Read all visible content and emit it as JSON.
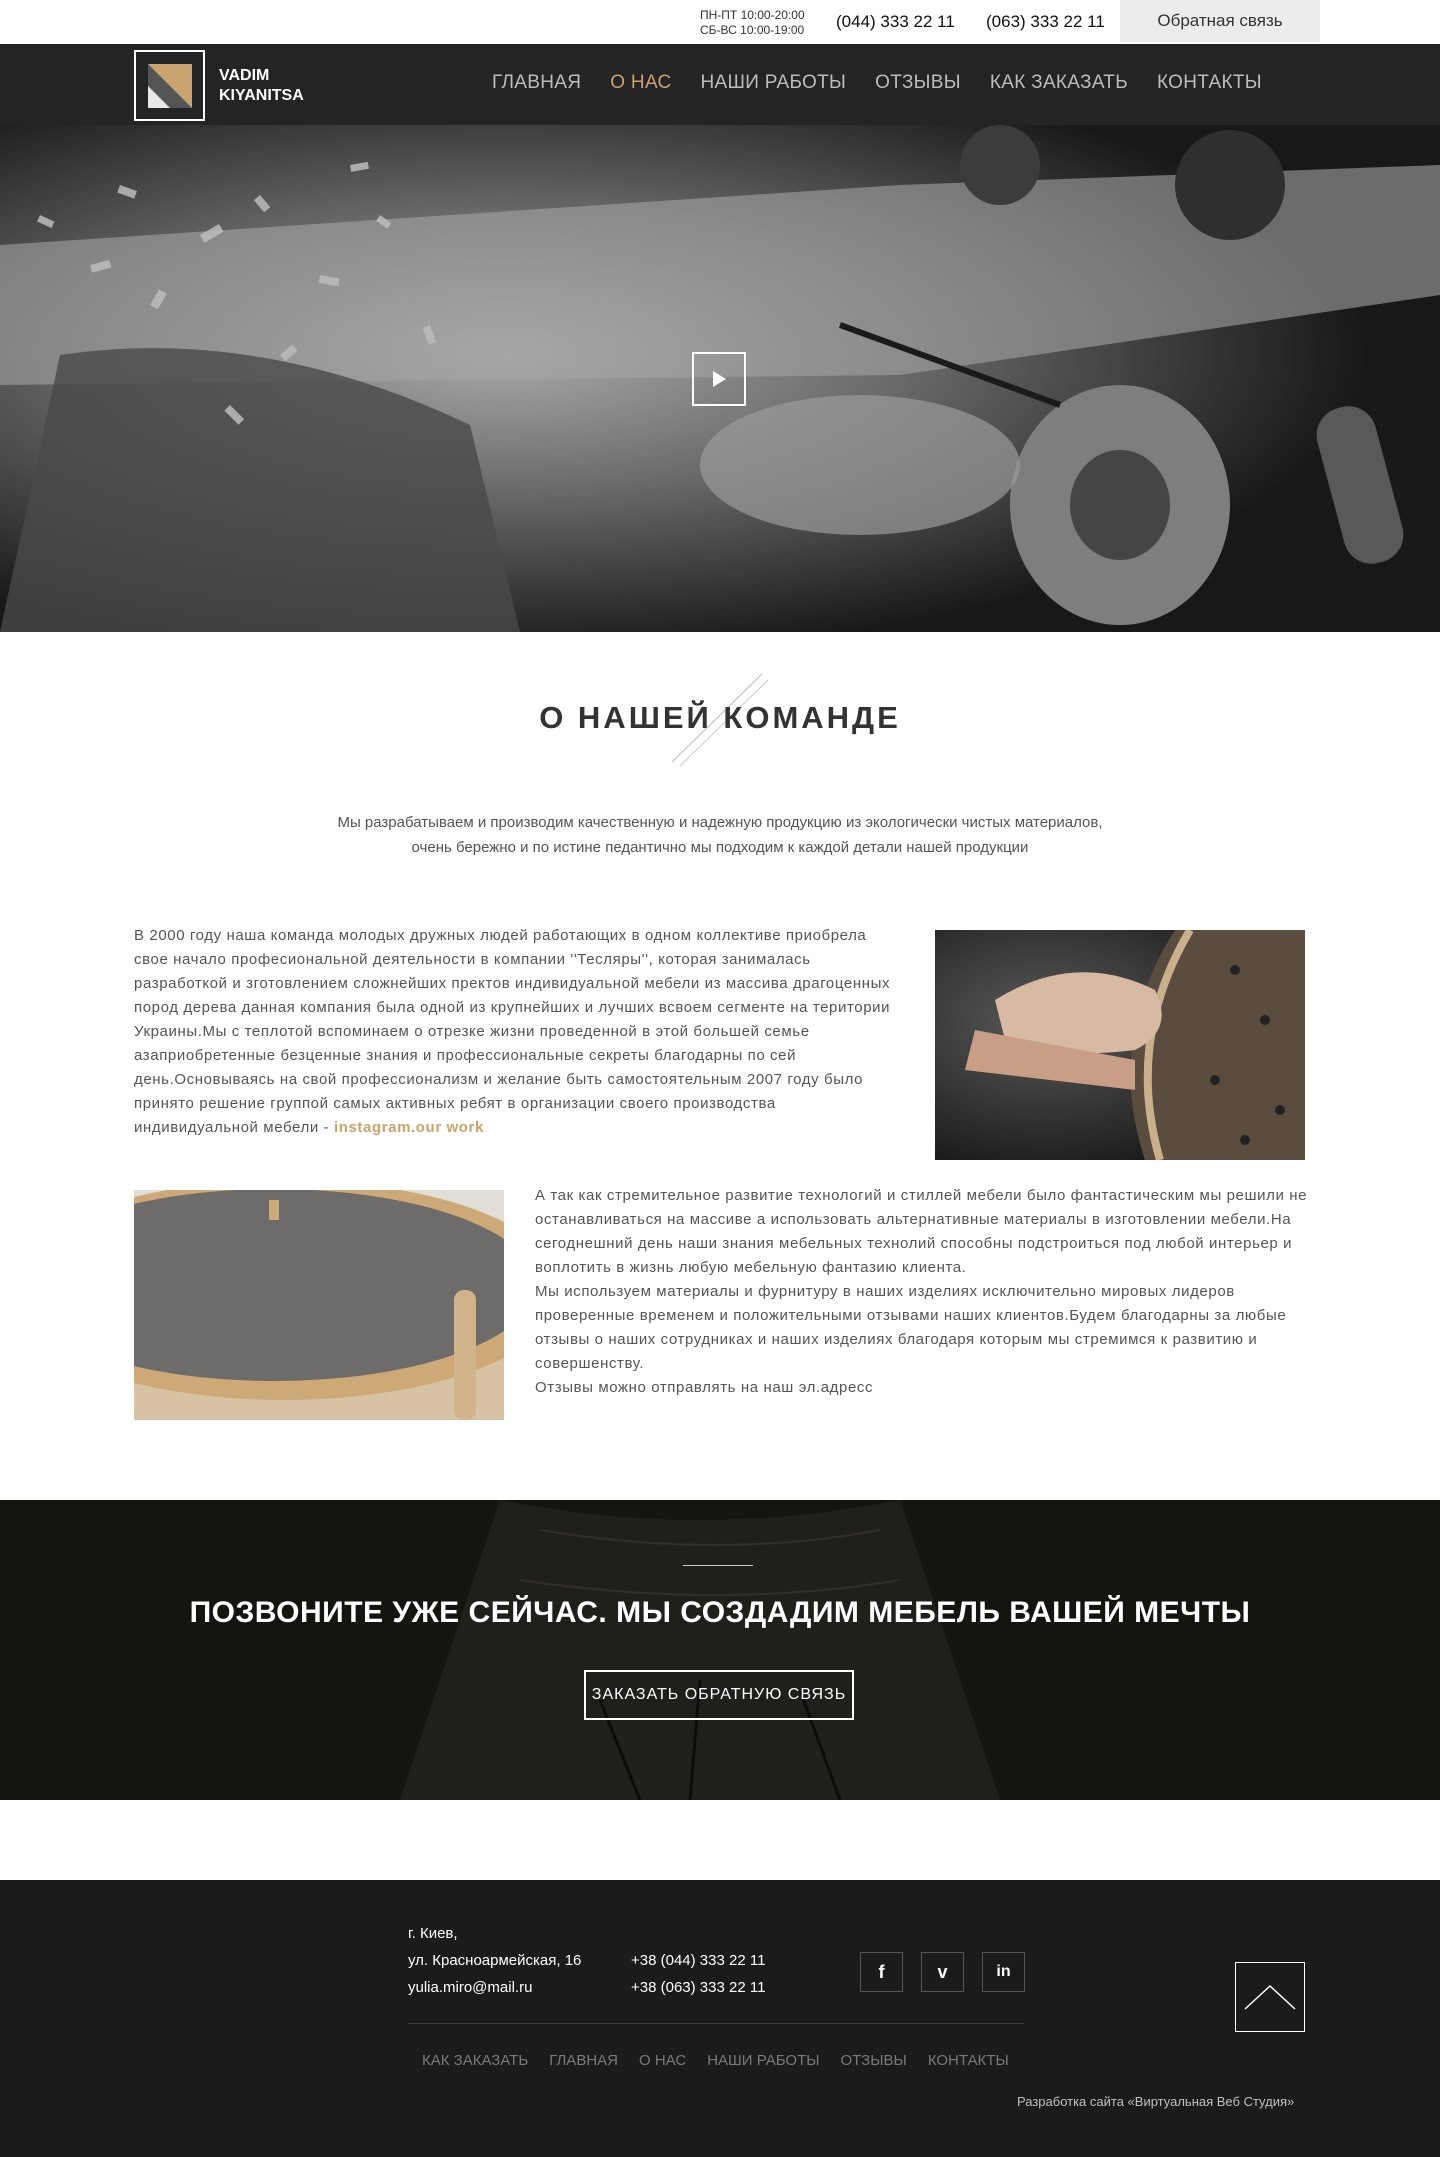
{
  "topbar": {
    "hours_weekdays": "ПН-ПТ 10:00-20:00",
    "hours_weekend": "СБ-ВС 10:00-19:00",
    "phone1": "(044) 333 22 11",
    "phone2": "(063) 333 22 11",
    "feedback_label": "Обратная связь"
  },
  "logo": {
    "line1": "VADIM",
    "line2": "KIYANITSA"
  },
  "nav": {
    "items": [
      {
        "label": "ГЛАВНАЯ"
      },
      {
        "label": "О НАС"
      },
      {
        "label": "НАШИ РАБОТЫ"
      },
      {
        "label": "ОТЗЫВЫ"
      },
      {
        "label": "КАК ЗАКАЗАТЬ"
      },
      {
        "label": "КОНТАКТЫ"
      }
    ],
    "active": "О НАС"
  },
  "about": {
    "title": "О НАШЕЙ КОМАНДЕ",
    "intro_line1": "Мы разрабатываем и производим качественную и надежную продукцию из экологически чистых материалов,",
    "intro_line2": "очень бережно и по истине педантично мы подходим к каждой детали нашей продукции",
    "para1": "В 2000 году наша команда молодых дружных людей работающих в одном коллективе приобрела свое начало професиональной деятельности в компании ''Тесляры'', которая занималась разработкой и зготовлением сложнейших пректов индивидуальной мебели из массива драгоценных пород дерева данная компания была одной из крупнейших и лучших всвоем сегменте на територии Украины.Мы с теплотой вспоминаем о отрезке жизни проведенной в этой большей семье азаприобретенные безценные знания и профессиональные секреты благодарны по сей день.Основываясь на свой профессионализм и желание быть самостоятельным 2007 году было принято решение группой самых активных ребят в организации своего производства индивидуальной мебели - ",
    "link": "instagram.our work",
    "para2": "А так как стремительное развитие технологий и стиллей мебели было фантастическим мы решили не останавливаться на массиве а использовать альтернативные материалы в изготовлении мебели.На сегоднешний день наши знания мебельных технолий способны подстроиться под любой интерьер и воплотить в жизнь любую мебельную фантазию клиента.",
    "para3": "Мы используем материалы и фурнитуру в наших изделиях исключительно мировых лидеров проверенные временем и положительными отзывами наших клиентов.Будем благодарны за любые отзывы о наших сотрудниках и наших изделиях благодаря которым мы стремимся к развитию и совершенству.",
    "para4": "Отзывы можно отправлять на наш эл.адресс"
  },
  "cta": {
    "title": "ПОЗВОНИТЕ УЖЕ СЕЙЧАС. МЫ СОЗДАДИМ МЕБЕЛЬ ВАШЕЙ МЕЧТЫ",
    "button": "ЗАКАЗАТЬ ОБРАТНУЮ СВЯЗЬ"
  },
  "footer": {
    "city": "г. Киев,",
    "street": "ул. Красноармейская, 16",
    "email": "yulia.miro@mail.ru",
    "phone1": "+38 (044) 333 22 11",
    "phone2": "+38 (063) 333 22 11",
    "social": [
      "f",
      "v",
      "in"
    ],
    "nav": [
      "КАК ЗАКАЗАТЬ",
      "ГЛАВНАЯ",
      "О НАС",
      "НАШИ РАБОТЫ",
      "ОТЗЫВЫ",
      "КОНТАКТЫ"
    ],
    "credit": "Разработка сайта «Виртуальная Веб Студия»"
  },
  "colors": {
    "accent": "#c9a36e",
    "nav_bg": "#242424",
    "footer_bg": "#1b1b1b"
  }
}
